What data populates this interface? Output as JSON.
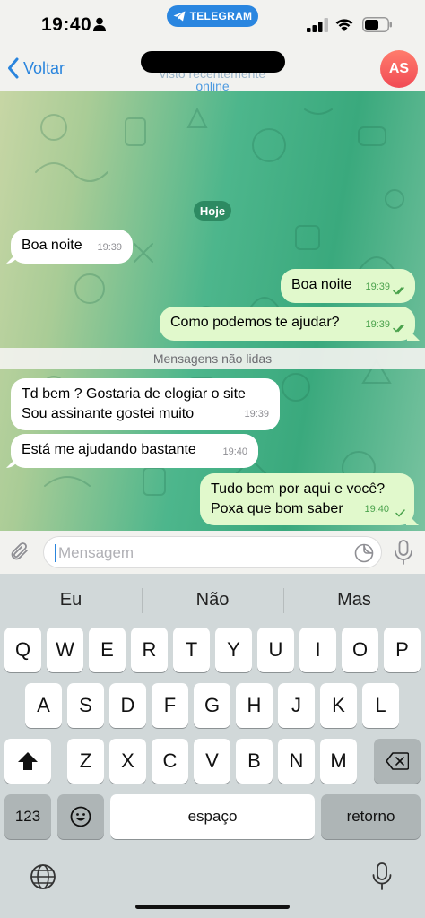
{
  "status_bar": {
    "time": "19:40",
    "app_pill": "TELEGRAM"
  },
  "header": {
    "back_label": "Voltar",
    "last_seen": "visto recentemente",
    "online": "online",
    "avatar_initials": "AS"
  },
  "chat": {
    "date_chip": "Hoje",
    "unread_divider": "Mensagens não lidas",
    "messages": [
      {
        "lines": [
          "Boa noite"
        ],
        "time": "19:39",
        "direction": "in"
      },
      {
        "lines": [
          "Boa noite"
        ],
        "time": "19:39",
        "direction": "out",
        "read": true
      },
      {
        "lines": [
          "Como podemos te ajudar?"
        ],
        "time": "19:39",
        "direction": "out",
        "read": true
      },
      {
        "lines": [
          "Td bem ? Gostaria de elogiar o site",
          "Sou assinante gostei muito"
        ],
        "time": "19:39",
        "direction": "in"
      },
      {
        "lines": [
          "Está me ajudando bastante"
        ],
        "time": "19:40",
        "direction": "in"
      },
      {
        "lines": [
          "Tudo bem por aqui e você?",
          "Poxa que bom saber"
        ],
        "time": "19:40",
        "direction": "out",
        "read": false
      }
    ]
  },
  "input": {
    "placeholder": "Mensagem"
  },
  "keyboard": {
    "suggestions": [
      "Eu",
      "Não",
      "Mas"
    ],
    "row1": [
      "Q",
      "W",
      "E",
      "R",
      "T",
      "Y",
      "U",
      "I",
      "O",
      "P"
    ],
    "row2": [
      "A",
      "S",
      "D",
      "F",
      "G",
      "H",
      "J",
      "K",
      "L"
    ],
    "row3": [
      "Z",
      "X",
      "C",
      "V",
      "B",
      "N",
      "M"
    ],
    "numbers_key": "123",
    "space_key": "espaço",
    "return_key": "retorno"
  },
  "colors": {
    "accent": "#2a85dd",
    "outgoing_bubble": "#e1f9cc",
    "incoming_bubble": "#ffffff",
    "read_check": "#4aa24c",
    "avatar": "#f14b55"
  }
}
